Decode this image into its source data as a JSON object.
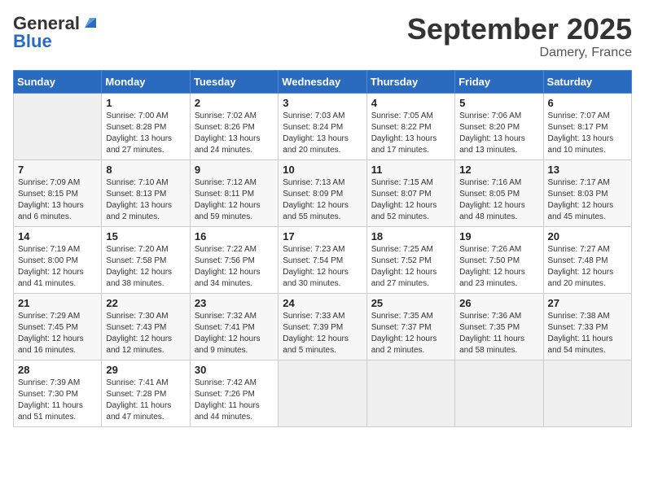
{
  "logo": {
    "general": "General",
    "blue": "Blue"
  },
  "header": {
    "month": "September 2025",
    "location": "Damery, France"
  },
  "weekdays": [
    "Sunday",
    "Monday",
    "Tuesday",
    "Wednesday",
    "Thursday",
    "Friday",
    "Saturday"
  ],
  "weeks": [
    [
      {
        "day": "",
        "info": ""
      },
      {
        "day": "1",
        "info": "Sunrise: 7:00 AM\nSunset: 8:28 PM\nDaylight: 13 hours\nand 27 minutes."
      },
      {
        "day": "2",
        "info": "Sunrise: 7:02 AM\nSunset: 8:26 PM\nDaylight: 13 hours\nand 24 minutes."
      },
      {
        "day": "3",
        "info": "Sunrise: 7:03 AM\nSunset: 8:24 PM\nDaylight: 13 hours\nand 20 minutes."
      },
      {
        "day": "4",
        "info": "Sunrise: 7:05 AM\nSunset: 8:22 PM\nDaylight: 13 hours\nand 17 minutes."
      },
      {
        "day": "5",
        "info": "Sunrise: 7:06 AM\nSunset: 8:20 PM\nDaylight: 13 hours\nand 13 minutes."
      },
      {
        "day": "6",
        "info": "Sunrise: 7:07 AM\nSunset: 8:17 PM\nDaylight: 13 hours\nand 10 minutes."
      }
    ],
    [
      {
        "day": "7",
        "info": "Sunrise: 7:09 AM\nSunset: 8:15 PM\nDaylight: 13 hours\nand 6 minutes."
      },
      {
        "day": "8",
        "info": "Sunrise: 7:10 AM\nSunset: 8:13 PM\nDaylight: 13 hours\nand 2 minutes."
      },
      {
        "day": "9",
        "info": "Sunrise: 7:12 AM\nSunset: 8:11 PM\nDaylight: 12 hours\nand 59 minutes."
      },
      {
        "day": "10",
        "info": "Sunrise: 7:13 AM\nSunset: 8:09 PM\nDaylight: 12 hours\nand 55 minutes."
      },
      {
        "day": "11",
        "info": "Sunrise: 7:15 AM\nSunset: 8:07 PM\nDaylight: 12 hours\nand 52 minutes."
      },
      {
        "day": "12",
        "info": "Sunrise: 7:16 AM\nSunset: 8:05 PM\nDaylight: 12 hours\nand 48 minutes."
      },
      {
        "day": "13",
        "info": "Sunrise: 7:17 AM\nSunset: 8:03 PM\nDaylight: 12 hours\nand 45 minutes."
      }
    ],
    [
      {
        "day": "14",
        "info": "Sunrise: 7:19 AM\nSunset: 8:00 PM\nDaylight: 12 hours\nand 41 minutes."
      },
      {
        "day": "15",
        "info": "Sunrise: 7:20 AM\nSunset: 7:58 PM\nDaylight: 12 hours\nand 38 minutes."
      },
      {
        "day": "16",
        "info": "Sunrise: 7:22 AM\nSunset: 7:56 PM\nDaylight: 12 hours\nand 34 minutes."
      },
      {
        "day": "17",
        "info": "Sunrise: 7:23 AM\nSunset: 7:54 PM\nDaylight: 12 hours\nand 30 minutes."
      },
      {
        "day": "18",
        "info": "Sunrise: 7:25 AM\nSunset: 7:52 PM\nDaylight: 12 hours\nand 27 minutes."
      },
      {
        "day": "19",
        "info": "Sunrise: 7:26 AM\nSunset: 7:50 PM\nDaylight: 12 hours\nand 23 minutes."
      },
      {
        "day": "20",
        "info": "Sunrise: 7:27 AM\nSunset: 7:48 PM\nDaylight: 12 hours\nand 20 minutes."
      }
    ],
    [
      {
        "day": "21",
        "info": "Sunrise: 7:29 AM\nSunset: 7:45 PM\nDaylight: 12 hours\nand 16 minutes."
      },
      {
        "day": "22",
        "info": "Sunrise: 7:30 AM\nSunset: 7:43 PM\nDaylight: 12 hours\nand 12 minutes."
      },
      {
        "day": "23",
        "info": "Sunrise: 7:32 AM\nSunset: 7:41 PM\nDaylight: 12 hours\nand 9 minutes."
      },
      {
        "day": "24",
        "info": "Sunrise: 7:33 AM\nSunset: 7:39 PM\nDaylight: 12 hours\nand 5 minutes."
      },
      {
        "day": "25",
        "info": "Sunrise: 7:35 AM\nSunset: 7:37 PM\nDaylight: 12 hours\nand 2 minutes."
      },
      {
        "day": "26",
        "info": "Sunrise: 7:36 AM\nSunset: 7:35 PM\nDaylight: 11 hours\nand 58 minutes."
      },
      {
        "day": "27",
        "info": "Sunrise: 7:38 AM\nSunset: 7:33 PM\nDaylight: 11 hours\nand 54 minutes."
      }
    ],
    [
      {
        "day": "28",
        "info": "Sunrise: 7:39 AM\nSunset: 7:30 PM\nDaylight: 11 hours\nand 51 minutes."
      },
      {
        "day": "29",
        "info": "Sunrise: 7:41 AM\nSunset: 7:28 PM\nDaylight: 11 hours\nand 47 minutes."
      },
      {
        "day": "30",
        "info": "Sunrise: 7:42 AM\nSunset: 7:26 PM\nDaylight: 11 hours\nand 44 minutes."
      },
      {
        "day": "",
        "info": ""
      },
      {
        "day": "",
        "info": ""
      },
      {
        "day": "",
        "info": ""
      },
      {
        "day": "",
        "info": ""
      }
    ]
  ]
}
